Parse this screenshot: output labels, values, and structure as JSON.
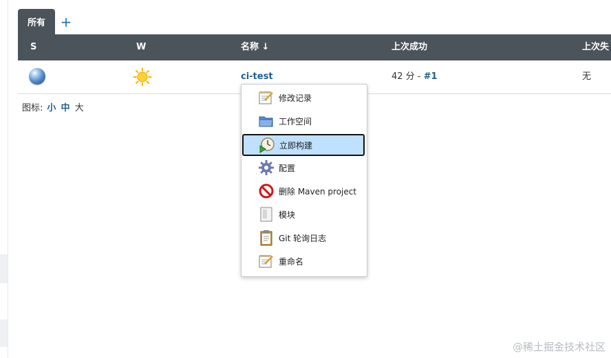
{
  "tabs": [
    {
      "label": "所有"
    }
  ],
  "tab_add_label": "+",
  "table": {
    "headers": {
      "status": "S",
      "weather": "W",
      "name": "名称 ↓",
      "last_success": "上次成功",
      "last_failure": "上次失"
    },
    "rows": [
      {
        "name": "ci-test",
        "last_success_prefix": "42 分 - ",
        "last_success_build": "#1",
        "last_failure": "无"
      }
    ]
  },
  "icon_size": {
    "label": "图标:",
    "sizes": [
      "小",
      "中",
      "大"
    ]
  },
  "context_menu": {
    "items": [
      {
        "label": "修改记录",
        "icon": "notepad-icon"
      },
      {
        "label": "工作空间",
        "icon": "folder-icon"
      },
      {
        "label": "立即构建",
        "icon": "clock-play-icon",
        "highlighted": true
      },
      {
        "label": "配置",
        "icon": "gear-icon"
      },
      {
        "label": "删除 Maven project",
        "icon": "no-entry-icon"
      },
      {
        "label": "模块",
        "icon": "document-icon"
      },
      {
        "label": "Git 轮询日志",
        "icon": "clipboard-icon"
      },
      {
        "label": "重命名",
        "icon": "notepad-icon"
      }
    ]
  },
  "watermark": "@稀土掘金技术社区",
  "colors": {
    "header_bg": "#4b535b",
    "link": "#1e5f8f",
    "add_tab": "#1b73b8",
    "highlight_bg": "#bfe0ff"
  }
}
